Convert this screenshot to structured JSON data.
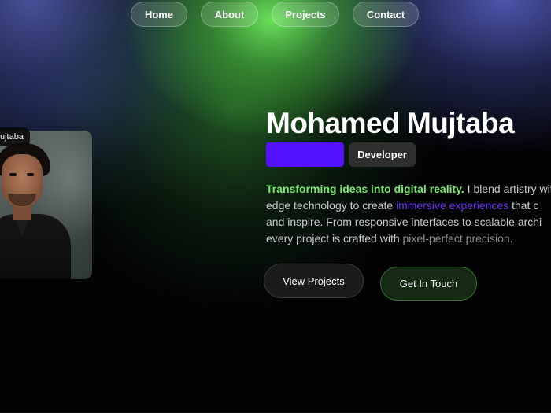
{
  "nav": {
    "home": "Home",
    "about": "About",
    "projects": "Projects",
    "contact": "Contact"
  },
  "profile": {
    "name_tag": "ujtaba"
  },
  "hero": {
    "name": "Mohamed Mujtaba",
    "role": "Developer",
    "bio": {
      "l1_highlight": "Transforming ideas into digital reality.",
      "l1_rest": " I blend artistry wit",
      "l2_start": "edge technology to create ",
      "l2_highlight": "immersive experiences",
      "l2_end": " that c",
      "l3": "and inspire. From responsive interfaces to scalable archi",
      "l4_start": "every project is crafted with ",
      "l4_highlight": "pixel-perfect precision",
      "l4_end": "."
    }
  },
  "buttons": {
    "view_projects": "View Projects",
    "get_in_touch": "Get In Touch"
  },
  "colors": {
    "accent_purple": "#5512ff",
    "accent_green": "#7dea71"
  }
}
